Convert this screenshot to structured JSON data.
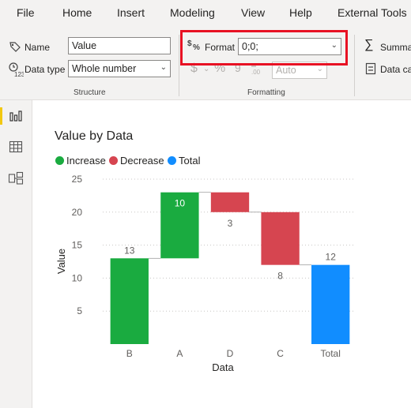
{
  "menu": {
    "file": "File",
    "home": "Home",
    "insert": "Insert",
    "modeling": "Modeling",
    "view": "View",
    "help": "Help",
    "external_tools": "External Tools"
  },
  "ribbon": {
    "name_label": "Name",
    "name_value": "Value",
    "datatype_label": "Data type",
    "datatype_value": "Whole number",
    "format_label": "Format",
    "format_value": "0;0;",
    "currency_symbol": "$",
    "percent_symbol": "%",
    "comma_symbol": "9",
    "auto_value": "Auto",
    "summarization_label": "Summa",
    "data_category_label": "Data ca",
    "structure_group": "Structure",
    "formatting_group": "Formatting"
  },
  "icons": [
    "name-tag-icon",
    "datatype-icon",
    "format-icon",
    "sum-icon",
    "data-category-icon",
    "report-view-icon",
    "data-view-icon",
    "model-view-icon"
  ],
  "colors": {
    "increase": "#1aab40",
    "decrease": "#d64550",
    "total": "#118dff",
    "highlight": "#e81123"
  },
  "chart_data": {
    "type": "waterfall",
    "title": "Value by Data",
    "xlabel": "Data",
    "ylabel": "Value",
    "ylim": [
      0,
      25
    ],
    "yticks": [
      5,
      10,
      15,
      20,
      25
    ],
    "legend": [
      "Increase",
      "Decrease",
      "Total"
    ],
    "legend_position": "top-left",
    "categories": [
      "B",
      "A",
      "D",
      "C",
      "Total"
    ],
    "values": [
      13,
      10,
      -3,
      -8,
      12
    ],
    "value_labels": [
      "13",
      "10",
      "3",
      "8",
      "12"
    ],
    "kinds": [
      "increase",
      "increase",
      "decrease",
      "decrease",
      "total"
    ],
    "grid": true
  }
}
